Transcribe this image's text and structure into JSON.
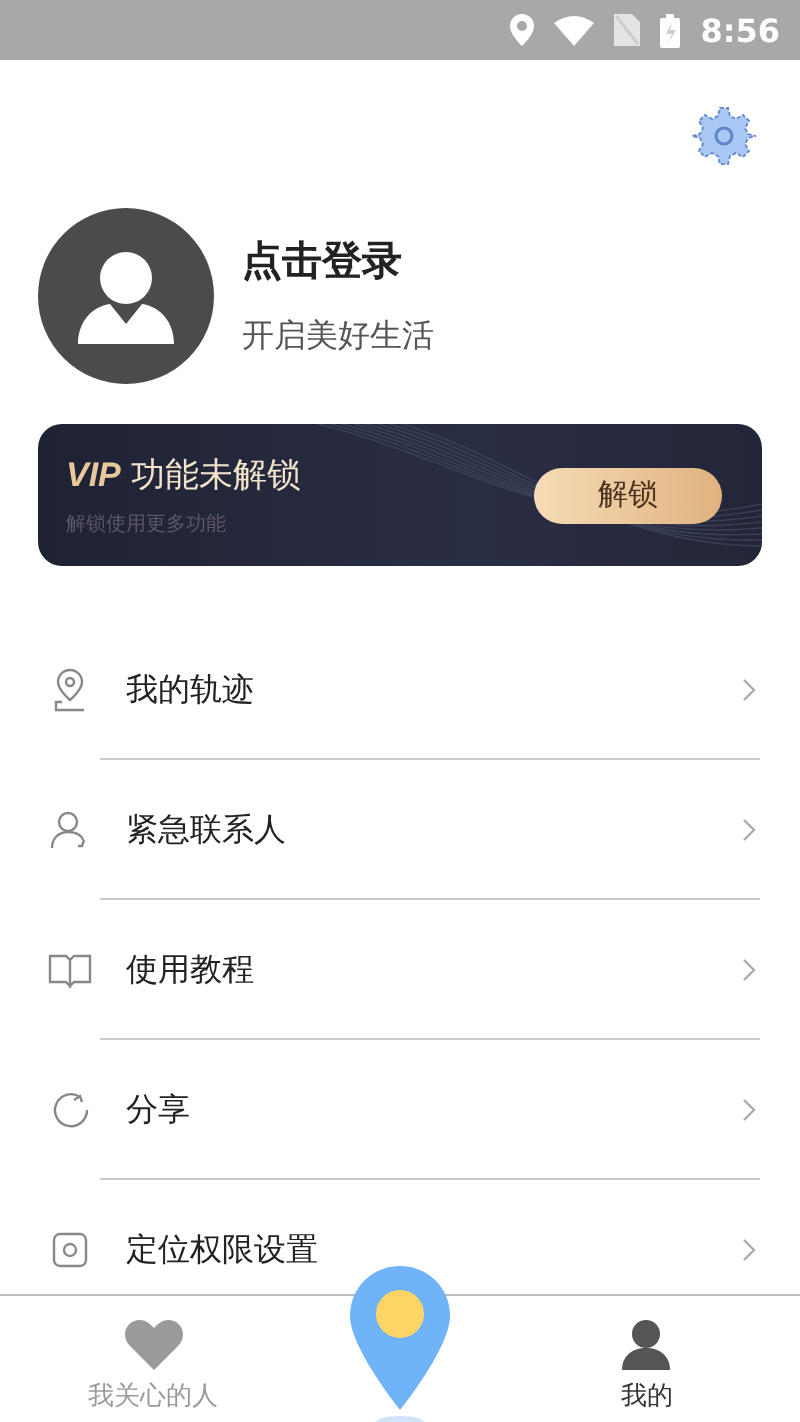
{
  "status_bar": {
    "time": "8:56"
  },
  "profile": {
    "name": "点击登录",
    "subtitle": "开启美好生活"
  },
  "vip": {
    "badge": "VIP",
    "title": "功能未解锁",
    "subtitle": "解锁使用更多功能",
    "button": "解锁"
  },
  "menu": [
    {
      "label": "我的轨迹",
      "kind": "pin"
    },
    {
      "label": "紧急联系人",
      "kind": "person"
    },
    {
      "label": "使用教程",
      "kind": "book"
    },
    {
      "label": "分享",
      "kind": "share"
    },
    {
      "label": "定位权限设置",
      "kind": "shield"
    }
  ],
  "tabs": [
    {
      "kind": "heart",
      "label": "我关心的人",
      "selected": false
    },
    {
      "kind": "locate",
      "selected": false
    },
    {
      "kind": "me",
      "label": "我的",
      "selected": true
    }
  ]
}
